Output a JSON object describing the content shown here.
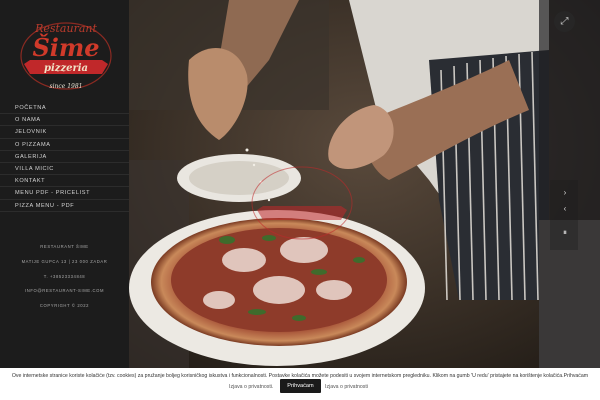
{
  "logo": {
    "name_top": "Restaurant",
    "name_main": "Šime",
    "banner": "pizzeria",
    "since": "since 1981"
  },
  "nav": {
    "items": [
      {
        "label": "Početna"
      },
      {
        "label": "O nama"
      },
      {
        "label": "Jelovnik"
      },
      {
        "label": "O pizzama"
      },
      {
        "label": "Galerija"
      },
      {
        "label": "Villa Micic"
      },
      {
        "label": "Kontakt"
      },
      {
        "label": "Menu PDF - Pricelist"
      },
      {
        "label": "Pizza Menu - PDF"
      }
    ]
  },
  "contact": {
    "name": "Restaurant Šime",
    "address": "Matije Gupca 13 | 23 000 Zadar",
    "phone": "T. +38523334848",
    "email": "info@restaurant-sime.com",
    "copyright": "Copyright © 2022"
  },
  "hero": {
    "fullscreen_icon": "expand-icon",
    "controls": [
      "chevron-right-icon",
      "chevron-left-icon",
      "pause-icon"
    ]
  },
  "cookie": {
    "text": "Ove internetske stranice koriste kolačiće (tzv. cookies) za pružanje boljeg korisničkog iskustva i funkcionalnosti. Postavke kolačića možete podesiti u svojem internetskom pregledniku. Klikom na gumb 'U redu' pristajete na korištenje kolačića.Prihvaćam",
    "privacy_link_left": "Izjava o privatnosti.",
    "accept_label": "Prihvaćam",
    "privacy_link_right": "Izjava o privatnosti"
  },
  "colors": {
    "sidebar_bg": "#1c1c1c",
    "logo_red": "#c0282a",
    "cookie_bg": "#ffffff",
    "accept_bg": "#1a1a1a"
  }
}
